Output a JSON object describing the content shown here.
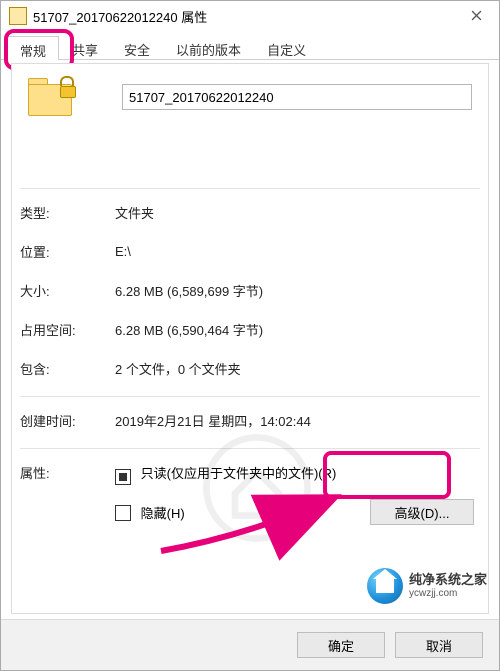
{
  "window": {
    "title": "51707_20170622012240 属性"
  },
  "tabs": {
    "general": "常规",
    "share": "共享",
    "security": "安全",
    "previous": "以前的版本",
    "custom": "自定义"
  },
  "name_value": "51707_20170622012240",
  "rows": {
    "type_lbl": "类型:",
    "type_val": "文件夹",
    "loc_lbl": "位置:",
    "loc_val": "E:\\",
    "size_lbl": "大小:",
    "size_val": "6.28 MB (6,589,699 字节)",
    "ondisk_lbl": "占用空间:",
    "ondisk_val": "6.28 MB (6,590,464 字节)",
    "contains_lbl": "包含:",
    "contains_val": "2 个文件，0 个文件夹",
    "created_lbl": "创建时间:",
    "created_val": "2019年2月21日 星期四，14:02:44",
    "attr_lbl": "属性:"
  },
  "checks": {
    "readonly": "只读(仅应用于文件夹中的文件)(R)",
    "hidden": "隐藏(H)"
  },
  "buttons": {
    "advanced": "高级(D)...",
    "ok": "确定",
    "cancel": "取消"
  },
  "watermark": {
    "line1": "纯净系统之家",
    "line2": "ycwzjj.com"
  }
}
